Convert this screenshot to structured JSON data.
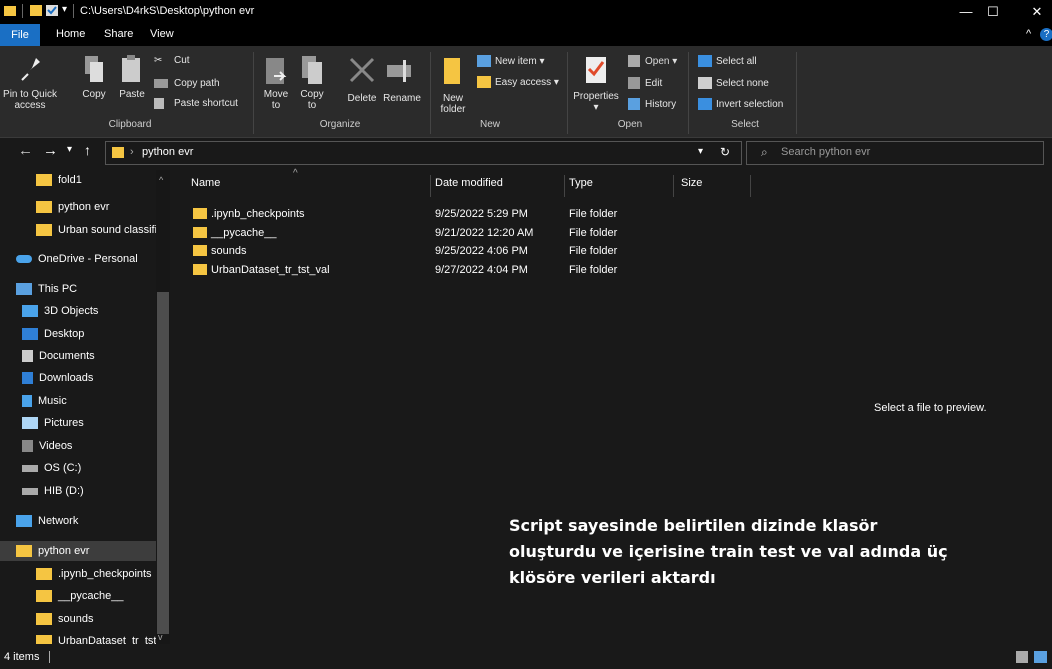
{
  "window": {
    "title": "C:\\Users\\D4rkS\\Desktop\\python evr",
    "controls": {
      "minimize": "—",
      "maximize": "☐",
      "close": "✕"
    }
  },
  "tabs": [
    "File",
    "Home",
    "Share",
    "View"
  ],
  "ribbon": {
    "clipboard": {
      "group": "Clipboard",
      "pin": "Pin to Quick access",
      "copy": "Copy",
      "paste": "Paste",
      "cut": "Cut",
      "copy_path": "Copy path",
      "paste_shortcut": "Paste shortcut"
    },
    "organize": {
      "group": "Organize",
      "move_to": "Move to",
      "copy_to": "Copy to",
      "delete": "Delete",
      "rename": "Rename"
    },
    "new": {
      "group": "New",
      "new_folder": "New folder",
      "new_item": "New item",
      "easy_access": "Easy access"
    },
    "open": {
      "group": "Open",
      "properties": "Properties",
      "open": "Open",
      "edit": "Edit",
      "history": "History"
    },
    "select": {
      "group": "Select",
      "select_all": "Select all",
      "select_none": "Select none",
      "invert": "Invert selection"
    }
  },
  "address": {
    "path": "python evr",
    "search_placeholder": "Search python evr"
  },
  "navpane": {
    "items": [
      {
        "label": "fold1",
        "icon": "folder"
      },
      {
        "label": "python evr",
        "icon": "folder"
      },
      {
        "label": "Urban sound classifi",
        "icon": "folder"
      },
      {
        "label": "OneDrive - Personal",
        "icon": "cloud"
      },
      {
        "label": "This PC",
        "icon": "pc"
      },
      {
        "label": "3D Objects",
        "icon": "3d"
      },
      {
        "label": "Desktop",
        "icon": "desktop"
      },
      {
        "label": "Documents",
        "icon": "documents"
      },
      {
        "label": "Downloads",
        "icon": "downloads"
      },
      {
        "label": "Music",
        "icon": "music"
      },
      {
        "label": "Pictures",
        "icon": "pictures"
      },
      {
        "label": "Videos",
        "icon": "videos"
      },
      {
        "label": "OS (C:)",
        "icon": "drive"
      },
      {
        "label": "HIB (D:)",
        "icon": "drive"
      },
      {
        "label": "Network",
        "icon": "network"
      },
      {
        "label": "python evr",
        "icon": "folder"
      },
      {
        "label": ".ipynb_checkpoints",
        "icon": "folder"
      },
      {
        "label": "__pycache__",
        "icon": "folder"
      },
      {
        "label": "sounds",
        "icon": "folder"
      },
      {
        "label": "UrbanDataset_tr_tst_",
        "icon": "folder"
      }
    ]
  },
  "filelist": {
    "columns": [
      "Name",
      "Date modified",
      "Type",
      "Size"
    ],
    "rows": [
      {
        "name": ".ipynb_checkpoints",
        "date": "9/25/2022 5:29 PM",
        "type": "File folder"
      },
      {
        "name": "__pycache__",
        "date": "9/21/2022 12:20 AM",
        "type": "File folder"
      },
      {
        "name": "sounds",
        "date": "9/25/2022 4:06 PM",
        "type": "File folder"
      },
      {
        "name": "UrbanDataset_tr_tst_val",
        "date": "9/27/2022 4:04 PM",
        "type": "File folder"
      }
    ]
  },
  "preview": {
    "message": "Select a file to preview."
  },
  "annotation": {
    "line1": "Script sayesinde belirtilen dizinde klasör",
    "line2": "oluşturdu ve içerisine train test ve val adında üç",
    "line3": "klösöre verileri aktardı"
  },
  "status": {
    "count": "4 items"
  },
  "colors": {
    "accent": "#1a6fc4",
    "folder": "#f5c542",
    "background": "#191919",
    "ribbon": "#2b2b2b"
  }
}
